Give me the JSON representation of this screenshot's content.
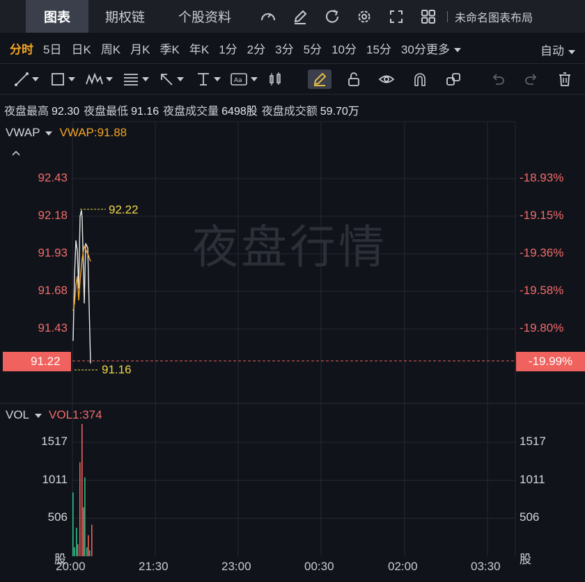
{
  "topnav": {
    "tabs": [
      {
        "label": "图表",
        "active": true
      },
      {
        "label": "期权链",
        "active": false
      },
      {
        "label": "个股资料",
        "active": false
      }
    ],
    "icons": [
      "gauge-icon",
      "edit-icon",
      "refresh-icon",
      "settings-icon",
      "fullscreen-icon",
      "grid-layout-icon"
    ],
    "layout_name": "未命名图表布局"
  },
  "periods": {
    "items": [
      "分时",
      "5日",
      "日K",
      "周K",
      "月K",
      "季K",
      "年K",
      "1分",
      "2分",
      "3分",
      "5分",
      "10分",
      "15分",
      "30分更多"
    ],
    "active": "分时",
    "auto_label": "自动"
  },
  "drawbar": {
    "tools": [
      "line-tool-icon",
      "rectangle-tool-icon",
      "wave-pattern-icon",
      "fib-tool-icon",
      "arrow-tool-icon",
      "measure-tool-icon",
      "text-tool-icon",
      "candle-tool-icon",
      "pen-icon",
      "unlock-icon",
      "eye-icon",
      "magnet-icon",
      "link-icon",
      "undo-icon",
      "redo-icon",
      "trash-icon"
    ]
  },
  "stats": {
    "high_label": "夜盘最高",
    "high_value": "92.30",
    "low_label": "夜盘最低",
    "low_value": "91.16",
    "volume_label": "夜盘成交量",
    "volume_value": "6498股",
    "turnover_label": "夜盘成交额",
    "turnover_value": "59.70万"
  },
  "price_panel": {
    "indicator": "VWAP",
    "indicator_value": "VWAP:91.88",
    "watermark": "夜盘行情",
    "left_ticks": [
      "92.43",
      "92.18",
      "91.93",
      "91.68",
      "91.43"
    ],
    "right_ticks": [
      "-18.93%",
      "-19.15%",
      "-19.36%",
      "-19.58%",
      "-19.80%"
    ],
    "current_price": "91.22",
    "current_pct": "-19.99%",
    "max_callout": "92.22",
    "min_callout": "91.16",
    "price_points": [
      91.35,
      91.78,
      92.02,
      91.95,
      91.7,
      92.18,
      92.22,
      92.16,
      91.6,
      92.0,
      91.97,
      91.2
    ],
    "vwap_points": [
      91.55,
      91.6,
      91.72,
      91.78,
      91.62,
      91.75,
      91.9,
      91.98,
      91.95,
      91.92,
      91.88
    ]
  },
  "volume_panel": {
    "indicator": "VOL",
    "indicator_value": "VOL1:374",
    "left_ticks": [
      "1517",
      "1011",
      "506"
    ],
    "right_ticks": [
      "1517",
      "1011",
      "506"
    ],
    "unit": "股",
    "bars": [
      {
        "v": 850,
        "c": "green"
      },
      {
        "v": 120,
        "c": "green"
      },
      {
        "v": 380,
        "c": "green"
      },
      {
        "v": 160,
        "c": "red"
      },
      {
        "v": 1250,
        "c": "red"
      },
      {
        "v": 1760,
        "c": "red"
      },
      {
        "v": 650,
        "c": "red"
      },
      {
        "v": 1050,
        "c": "green"
      },
      {
        "v": 120,
        "c": "green"
      },
      {
        "v": 280,
        "c": "red"
      },
      {
        "v": 80,
        "c": "green"
      },
      {
        "v": 420,
        "c": "red"
      }
    ]
  },
  "x_ticks": [
    "20:00",
    "21:30",
    "23:00",
    "00:30",
    "02:00",
    "03:30"
  ],
  "colors": {
    "up": "#f0625e",
    "down": "#2ebd85",
    "vwap": "#f5a623",
    "price": "#e8e8e8"
  }
}
